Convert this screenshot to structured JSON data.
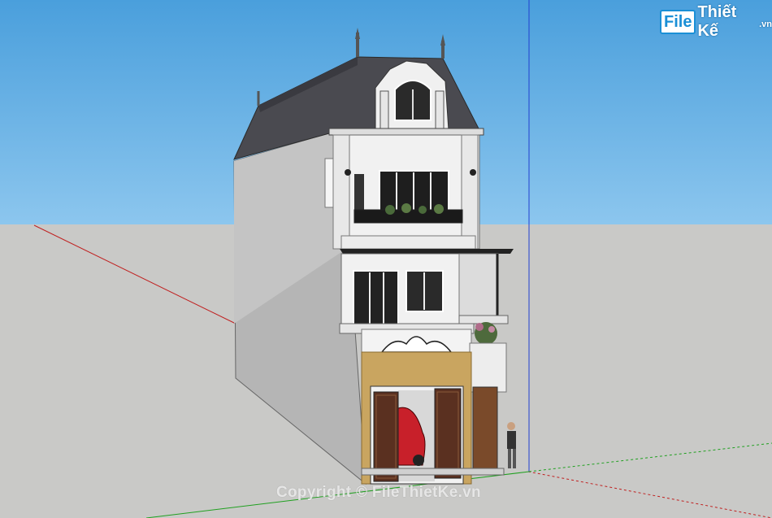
{
  "image": {
    "kind": "3d-model-render",
    "subject": "three-storey townhouse with mansard roof",
    "background": {
      "sky": "#5aaee6",
      "sky_top": "#4a9fdc",
      "ground": "#c8c8c6"
    }
  },
  "watermark": {
    "logo_badge": "File",
    "logo_text": "Thiết Kế",
    "logo_tld": ".vn",
    "copyright": "Copyright © FileThietKe.vn"
  },
  "colors": {
    "roof": "#4a4a50",
    "wall_white": "#f2f2f2",
    "side_wall": "#b8b8b8",
    "gate_frame": "#c9a560",
    "door_wood": "#5a3020",
    "car_red": "#c8202a",
    "axis_red": "#c02020",
    "axis_green": "#20a020",
    "axis_blue": "#2040d0"
  }
}
